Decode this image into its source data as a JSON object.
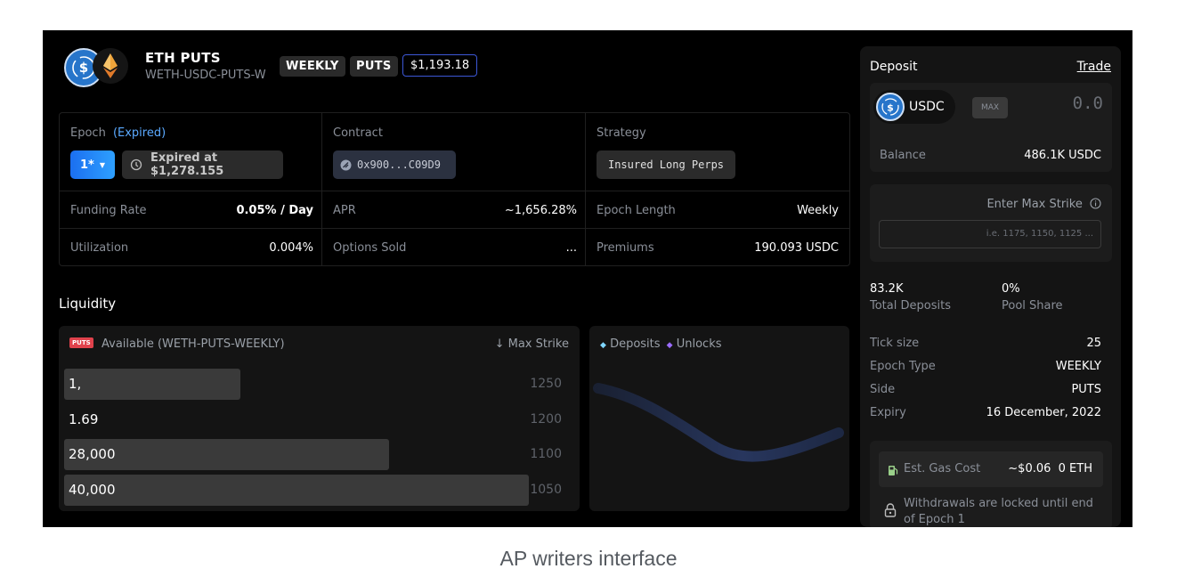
{
  "header": {
    "title": "ETH PUTS",
    "subtitle": "WETH-USDC-PUTS-W",
    "tags": [
      "WEEKLY",
      "PUTS"
    ],
    "price": "$1,193.18"
  },
  "info": {
    "epoch_label": "Epoch",
    "epoch_status": "(Expired)",
    "epoch_value": "1*",
    "expired_text": "Expired at $1,278.155",
    "contract_label": "Contract",
    "contract_value": "0x900...C09D9",
    "strategy_label": "Strategy",
    "strategy_value": "Insured Long Perps",
    "funding_rate_label": "Funding Rate",
    "funding_rate_value": "0.05% / Day",
    "apr_label": "APR",
    "apr_value": "~1,656.28%",
    "epoch_length_label": "Epoch Length",
    "epoch_length_value": "Weekly",
    "utilization_label": "Utilization",
    "utilization_value": "0.004%",
    "options_sold_label": "Options Sold",
    "options_sold_value": "...",
    "premiums_label": "Premiums",
    "premiums_value": "190.093 USDC"
  },
  "liquidity": {
    "title": "Liquidity",
    "badge": "PUTS",
    "available_label": "Available (WETH-PUTS-WEEKLY)",
    "max_strike_label": "Max Strike",
    "rows": [
      {
        "value": "1,",
        "strike": "1250",
        "fill": 0.38
      },
      {
        "value": "1.69",
        "strike": "1200",
        "fill": 0
      },
      {
        "value": "28,000",
        "strike": "1100",
        "fill": 0.7
      },
      {
        "value": "40,000",
        "strike": "1050",
        "fill": 1.0
      }
    ],
    "legend_deposits": "Deposits",
    "legend_unlocks": "Unlocks"
  },
  "deposit_panel": {
    "title": "Deposit",
    "trade_link": "Trade",
    "token": "USDC",
    "max_label": "MAX",
    "amount": "0.0",
    "balance_label": "Balance",
    "balance_value": "486.1K USDC",
    "enter_max_strike_label": "Enter Max Strike",
    "strike_placeholder": "i.e. 1175, 1150, 1125 ...",
    "total_deposits_value": "83.2K",
    "total_deposits_label": "Total Deposits",
    "pool_share_value": "0%",
    "pool_share_label": "Pool Share",
    "tick_size_label": "Tick size",
    "tick_size_value": "25",
    "epoch_type_label": "Epoch Type",
    "epoch_type_value": "WEEKLY",
    "side_label": "Side",
    "side_value": "PUTS",
    "expiry_label": "Expiry",
    "expiry_value": "16 December, 2022",
    "gas_label": "Est. Gas Cost",
    "gas_value": "~$0.06",
    "gas_eth": "0 ETH",
    "withdraw_notice": "Withdrawals are locked until end of Epoch 1"
  },
  "caption": "AP writers interface",
  "colors": {
    "accent_blue": "#2ea0ff",
    "usdc_blue": "#2775ca",
    "puts_badge": "#e0424c",
    "legend_deposits": "#7fd6ff",
    "legend_unlocks": "#9b6cff"
  }
}
